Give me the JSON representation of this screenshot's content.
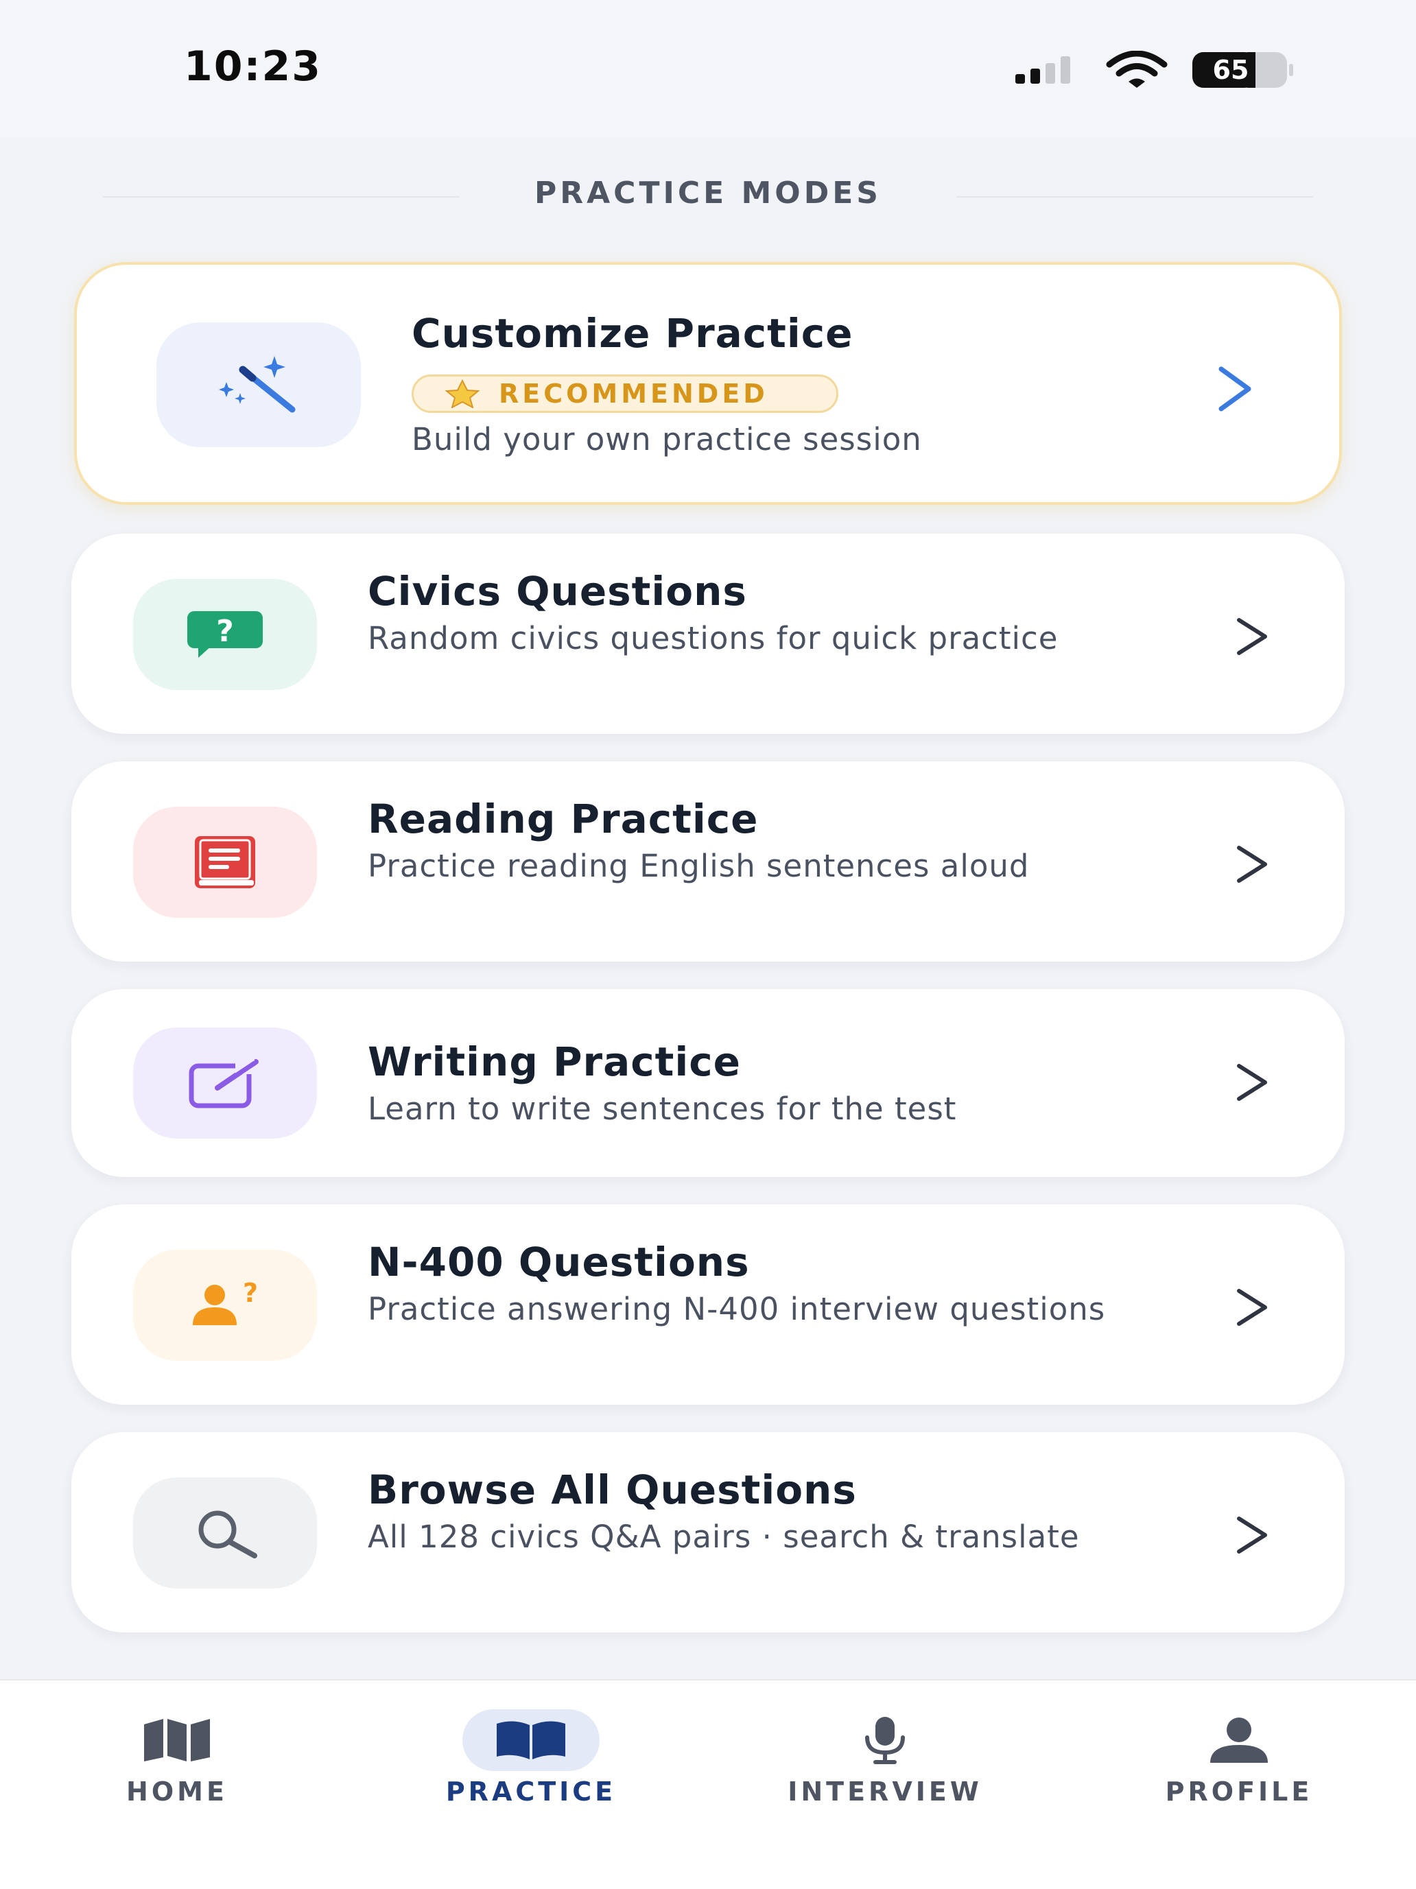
{
  "status_bar": {
    "time": "10:23",
    "battery": "65",
    "icons": [
      "signal-icon",
      "wifi-icon",
      "battery-icon"
    ]
  },
  "section": {
    "title": "PRACTICE MODES"
  },
  "featured_card": {
    "title": "Customize Practice",
    "badge": "RECOMMENDED",
    "description": "Build your own practice session",
    "icon": "magic-wand-icon",
    "accent": "#3b7be0"
  },
  "cards": [
    {
      "title": "Civics Questions",
      "description": "Random civics questions for quick practice",
      "icon": "question-bubble-icon",
      "color": "#1fa572"
    },
    {
      "title": "Reading Practice",
      "description": "Practice reading English sentences aloud",
      "icon": "book-icon",
      "color": "#e0403f"
    },
    {
      "title": "Writing Practice",
      "description": "Learn to write sentences for the test",
      "icon": "edit-icon",
      "color": "#8a5ce6"
    },
    {
      "title": "N-400 Questions",
      "description": "Practice answering N-400 interview questions",
      "icon": "person-question-icon",
      "color": "#f39a1e"
    },
    {
      "title": "Browse All Questions",
      "description": "All 128 civics Q&A pairs · search & translate",
      "icon": "search-icon",
      "color": "#5a606c"
    }
  ],
  "nav": {
    "active": "PRACTICE",
    "items": [
      {
        "label": "HOME",
        "icon": "map-icon"
      },
      {
        "label": "PRACTICE",
        "icon": "open-book-icon"
      },
      {
        "label": "INTERVIEW",
        "icon": "microphone-icon"
      },
      {
        "label": "PROFILE",
        "icon": "person-icon"
      }
    ]
  }
}
